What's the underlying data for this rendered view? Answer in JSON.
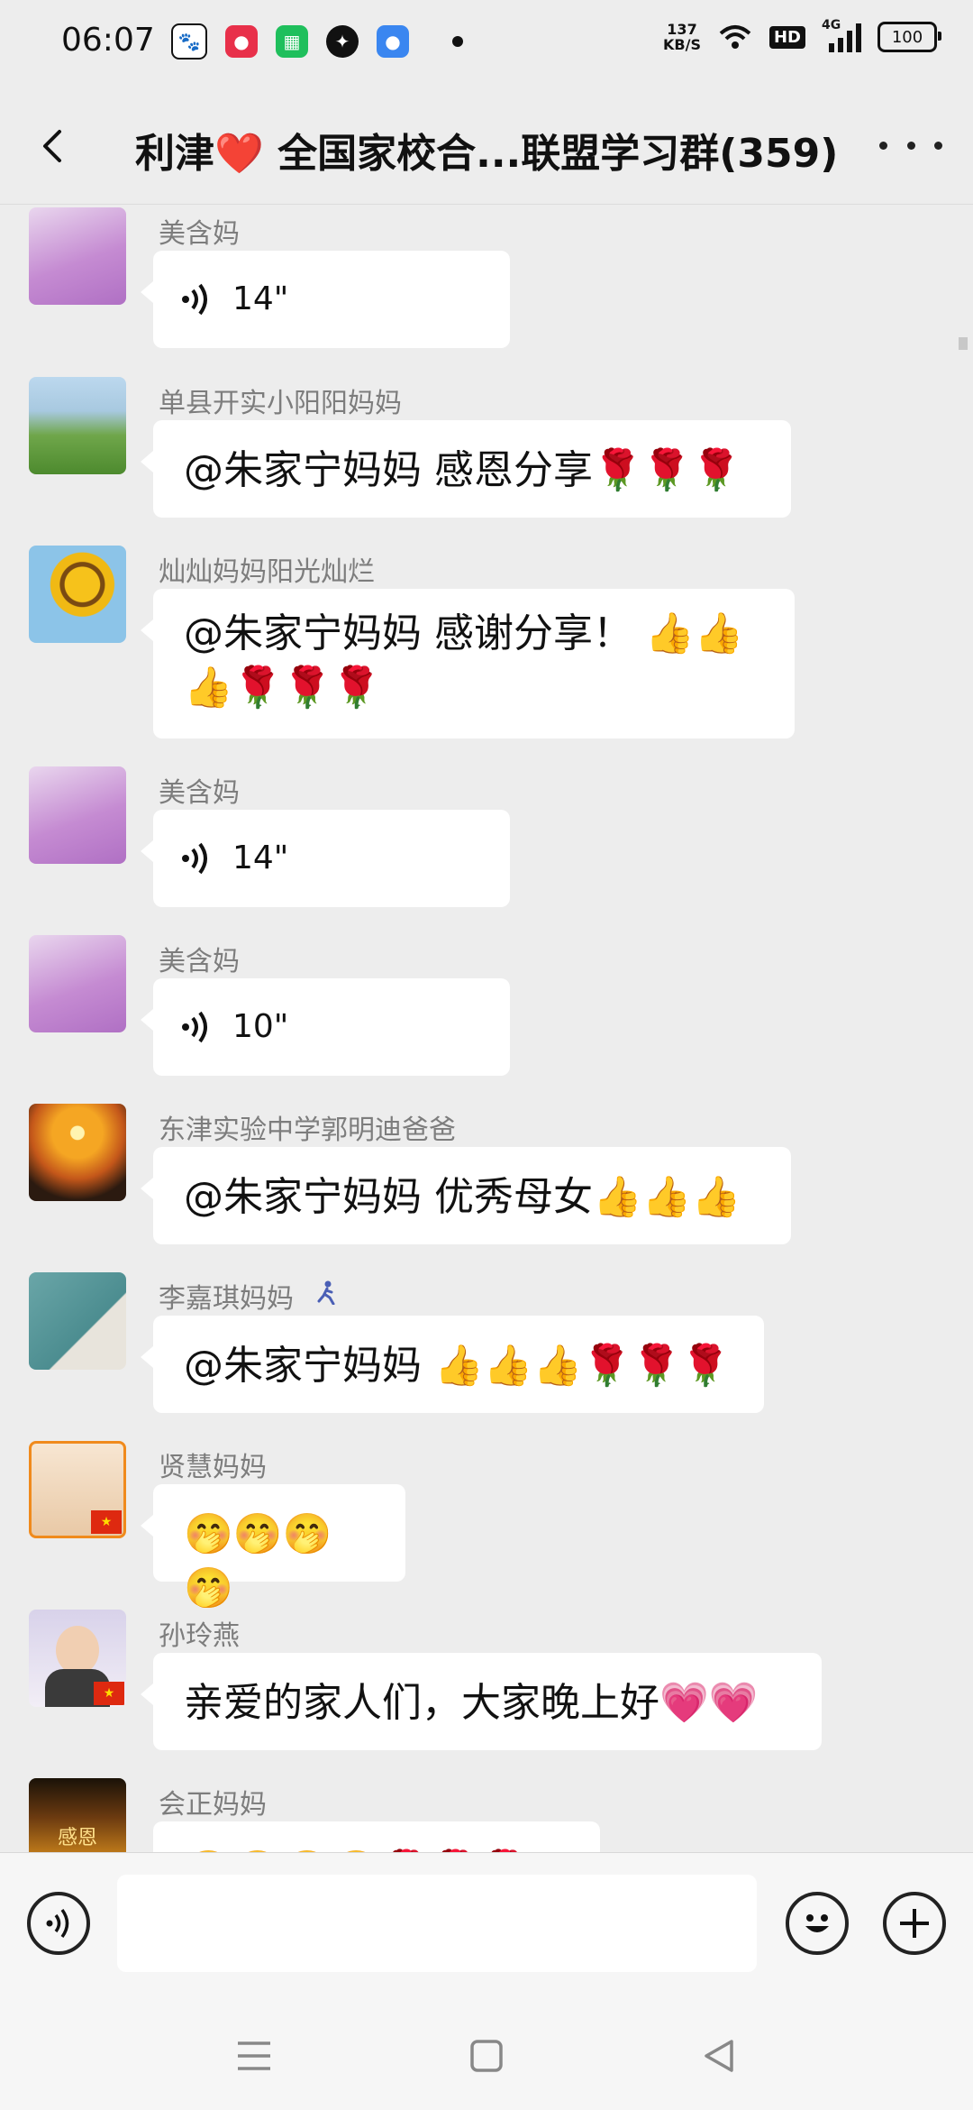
{
  "status_bar": {
    "time": "06:07",
    "net_speed_value": "137",
    "net_speed_unit": "KB/S",
    "hd_label": "HD",
    "signal_label": "4G",
    "battery": "100"
  },
  "header": {
    "title": "利津❤️ 全国家校合...联盟学习群(359)"
  },
  "messages": [
    {
      "sender": "美含妈",
      "voice_duration": "14\""
    },
    {
      "sender": "单县开实小阳阳妈妈",
      "text": "@朱家宁妈妈  感恩分享🌹🌹🌹"
    },
    {
      "sender": "灿灿妈妈阳光灿烂",
      "text_line1": "@朱家宁妈妈  感谢分享！ 👍👍",
      "text_line2": "👍🌹🌹🌹"
    },
    {
      "sender": "美含妈",
      "voice_duration": "14\""
    },
    {
      "sender": "美含妈",
      "voice_duration": "10\""
    },
    {
      "sender": "东津实验中学郭明迪爸爸",
      "text": "@朱家宁妈妈  优秀母女👍👍👍"
    },
    {
      "sender": "李嘉琪妈妈",
      "text": "@朱家宁妈妈 👍👍👍🌹🌹🌹"
    },
    {
      "sender": "贤慧妈妈",
      "text": "🤭🤭🤭🤭"
    },
    {
      "sender": "孙玲燕",
      "text": "亲爱的家人们，大家晚上好💗💗"
    },
    {
      "sender": "会正妈妈",
      "text": "🤭🤭🤭🤭🌹🌹🌹🌹"
    }
  ],
  "avatar_texts": {
    "huizheng": "感恩"
  },
  "colors": {
    "background": "#ededed",
    "bubble": "#ffffff",
    "sender_name": "#7d7d7d"
  },
  "input_bar": {
    "placeholder": ""
  }
}
